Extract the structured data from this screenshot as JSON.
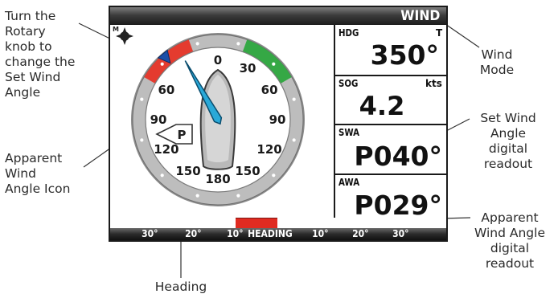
{
  "callouts": {
    "rotary": [
      "Turn the",
      "Rotary",
      "knob to",
      "change the",
      "Set Wind",
      "Angle"
    ],
    "awa_icon": [
      "Apparent",
      "Wind",
      "Angle Icon"
    ],
    "heading": "Heading",
    "wind_mode": [
      "Wind",
      "Mode"
    ],
    "swa_readout": [
      "Set Wind",
      "Angle",
      "digital",
      "readout"
    ],
    "awa_readout": [
      "Apparent",
      "Wind Angle",
      "digital",
      "readout"
    ]
  },
  "screen": {
    "title": "WIND",
    "cells": {
      "hdg": {
        "label": "HDG",
        "unit": "T",
        "value": "350°"
      },
      "sog": {
        "label": "SOG",
        "unit": "kts",
        "value": "4.2"
      },
      "swa": {
        "label": "SWA",
        "value": "P040°"
      },
      "awa": {
        "label": "AWA",
        "value": "P029°"
      }
    },
    "dial": {
      "labels": [
        "0",
        "30",
        "60",
        "90",
        "120",
        "150",
        "180",
        "150",
        "120",
        "90",
        "60"
      ],
      "boat_marker": "P",
      "set_wind_angle_deg": 40,
      "apparent_wind_angle_deg": 29,
      "port_color": "#e43b2f",
      "starboard_color": "#35a845"
    },
    "heading_bar": {
      "labels": [
        "30°",
        "20°",
        "10°",
        "HEADING",
        "10°",
        "20°",
        "30°"
      ],
      "marker_color": "#e02b21"
    }
  }
}
